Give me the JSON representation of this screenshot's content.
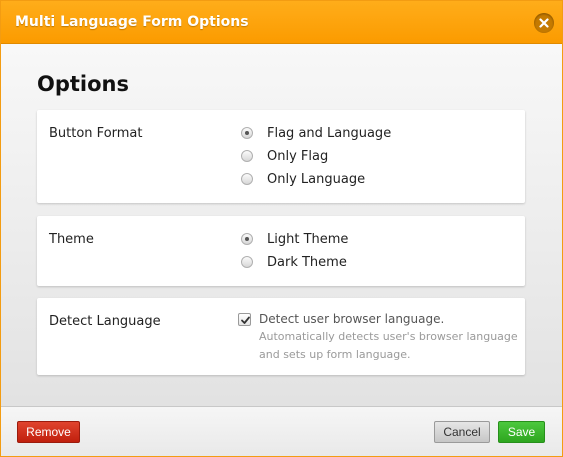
{
  "dialog": {
    "title": "Multi Language Form Options",
    "heading": "Options"
  },
  "sections": {
    "button_format": {
      "label": "Button Format",
      "options": [
        {
          "label": "Flag and Language",
          "selected": true
        },
        {
          "label": "Only Flag",
          "selected": false
        },
        {
          "label": "Only Language",
          "selected": false
        }
      ]
    },
    "theme": {
      "label": "Theme",
      "options": [
        {
          "label": "Light Theme",
          "selected": true
        },
        {
          "label": "Dark Theme",
          "selected": false
        }
      ]
    },
    "detect_language": {
      "label": "Detect Language",
      "checkbox_label": "Detect user browser language.",
      "checked": true,
      "hint": "Automatically detects user's browser language and sets up form language."
    }
  },
  "footer": {
    "remove_label": "Remove",
    "cancel_label": "Cancel",
    "save_label": "Save"
  },
  "colors": {
    "titlebar": "#fb9b00",
    "remove_button": "#c01f0d",
    "save_button": "#2ea61f"
  },
  "icons": {
    "close": "close-icon",
    "checkmark": "checkmark-icon"
  }
}
